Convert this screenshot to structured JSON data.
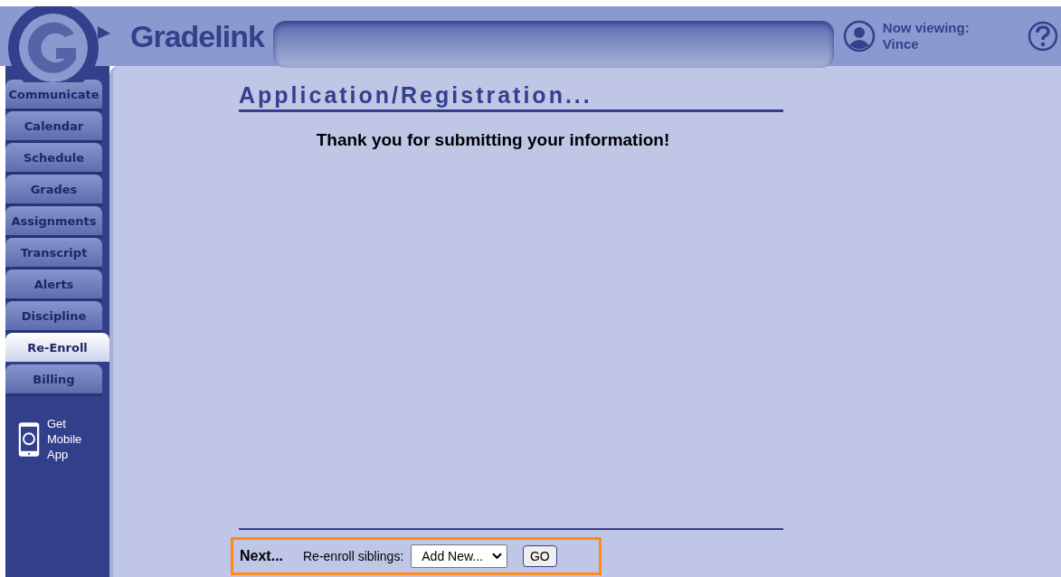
{
  "header": {
    "brand": "Gradelink",
    "viewing_label": "Now viewing:",
    "viewing_name": "Vince"
  },
  "sidebar": {
    "items": [
      {
        "label": "Communicate",
        "selected": false
      },
      {
        "label": "Calendar",
        "selected": false
      },
      {
        "label": "Schedule",
        "selected": false
      },
      {
        "label": "Grades",
        "selected": false
      },
      {
        "label": "Assignments",
        "selected": false
      },
      {
        "label": "Transcript",
        "selected": false
      },
      {
        "label": "Alerts",
        "selected": false
      },
      {
        "label": "Discipline",
        "selected": false
      },
      {
        "label": "Re-Enroll",
        "selected": true
      },
      {
        "label": "Billing",
        "selected": false
      }
    ],
    "mobile_app": [
      "Get",
      "Mobile",
      "App"
    ]
  },
  "page": {
    "title": "Application/Registration...",
    "message": "Thank you for submitting your information!"
  },
  "footer": {
    "next_label": "Next...",
    "select_label": "Re-enroll siblings:",
    "select_value": "Add New...",
    "go_button": "GO"
  }
}
